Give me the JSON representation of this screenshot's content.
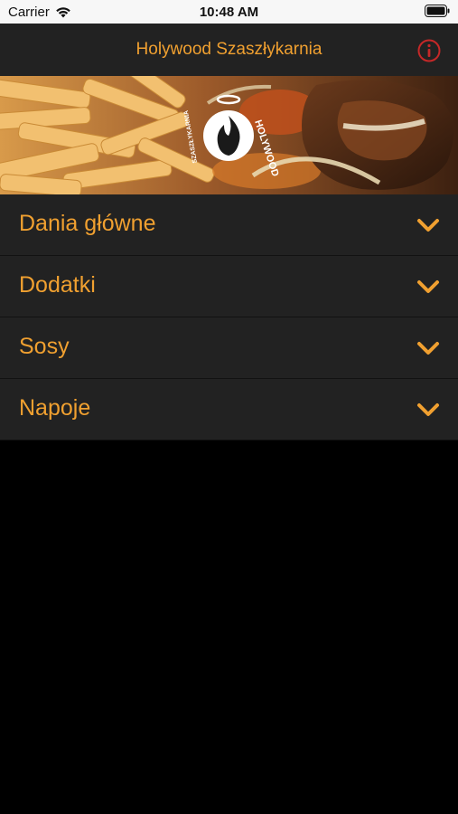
{
  "status_bar": {
    "carrier": "Carrier",
    "time": "10:48 AM"
  },
  "nav": {
    "title": "Holywood Szaszłykarnia",
    "accent_color": "#f0a030",
    "info_icon": "info-icon",
    "info_color": "#c62828"
  },
  "hero": {
    "logo_text_top": "HOLYWOOD",
    "logo_text_side": "SZASZŁYKARNIA"
  },
  "menu": {
    "items": [
      {
        "label": "Dania główne"
      },
      {
        "label": "Dodatki"
      },
      {
        "label": "Sosy"
      },
      {
        "label": "Napoje"
      }
    ]
  }
}
